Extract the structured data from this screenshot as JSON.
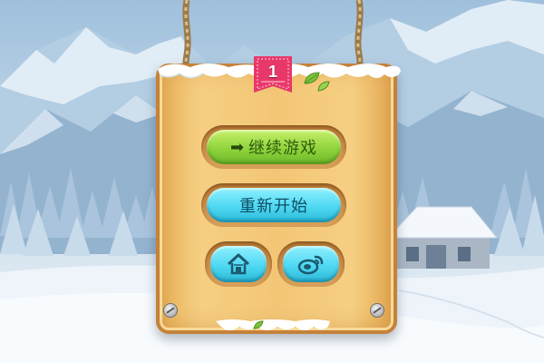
{
  "level": {
    "number": "1"
  },
  "menu": {
    "continue_label": "继续游戏",
    "restart_label": "重新开始"
  },
  "icons": {
    "continue": "arrow-right-icon",
    "home": "home-icon",
    "weibo": "weibo-icon"
  },
  "colors": {
    "green_button": "#8fd43c",
    "blue_button": "#4fd8f2",
    "board_wood": "#f3c676",
    "ribbon": "#e8386a"
  }
}
